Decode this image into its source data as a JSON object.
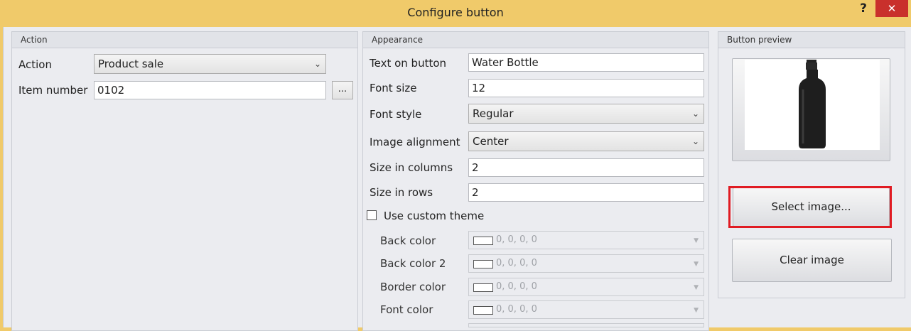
{
  "window": {
    "title": "Configure button",
    "help_label": "?",
    "close_label": "✕"
  },
  "action_group": {
    "header": "Action",
    "action_label": "Action",
    "action_value": "Product sale",
    "item_number_label": "Item number",
    "item_number_value": "0102",
    "browse_label": "..."
  },
  "appearance_group": {
    "header": "Appearance",
    "text_on_button_label": "Text on button",
    "text_on_button_value": "Water Bottle",
    "font_size_label": "Font size",
    "font_size_value": "12",
    "font_style_label": "Font style",
    "font_style_value": "Regular",
    "image_alignment_label": "Image alignment",
    "image_alignment_value": "Center",
    "size_columns_label": "Size in columns",
    "size_columns_value": "2",
    "size_rows_label": "Size in rows",
    "size_rows_value": "2",
    "custom_theme_label": "Use custom theme",
    "custom_theme_checked": false,
    "back_color_label": "Back color",
    "back_color_value": "0, 0, 0, 0",
    "back_color2_label": "Back color 2",
    "back_color2_value": "0, 0, 0, 0",
    "border_color_label": "Border color",
    "border_color_value": "0, 0, 0, 0",
    "font_color_label": "Font color",
    "font_color_value": "0, 0, 0, 0"
  },
  "preview_group": {
    "header": "Button preview",
    "image": "water-bottle-image",
    "select_image_label": "Select image...",
    "clear_image_label": "Clear image"
  },
  "colors": {
    "titlebar": "#f0ca6a",
    "close": "#c9302c",
    "highlight": "#e01b23"
  }
}
